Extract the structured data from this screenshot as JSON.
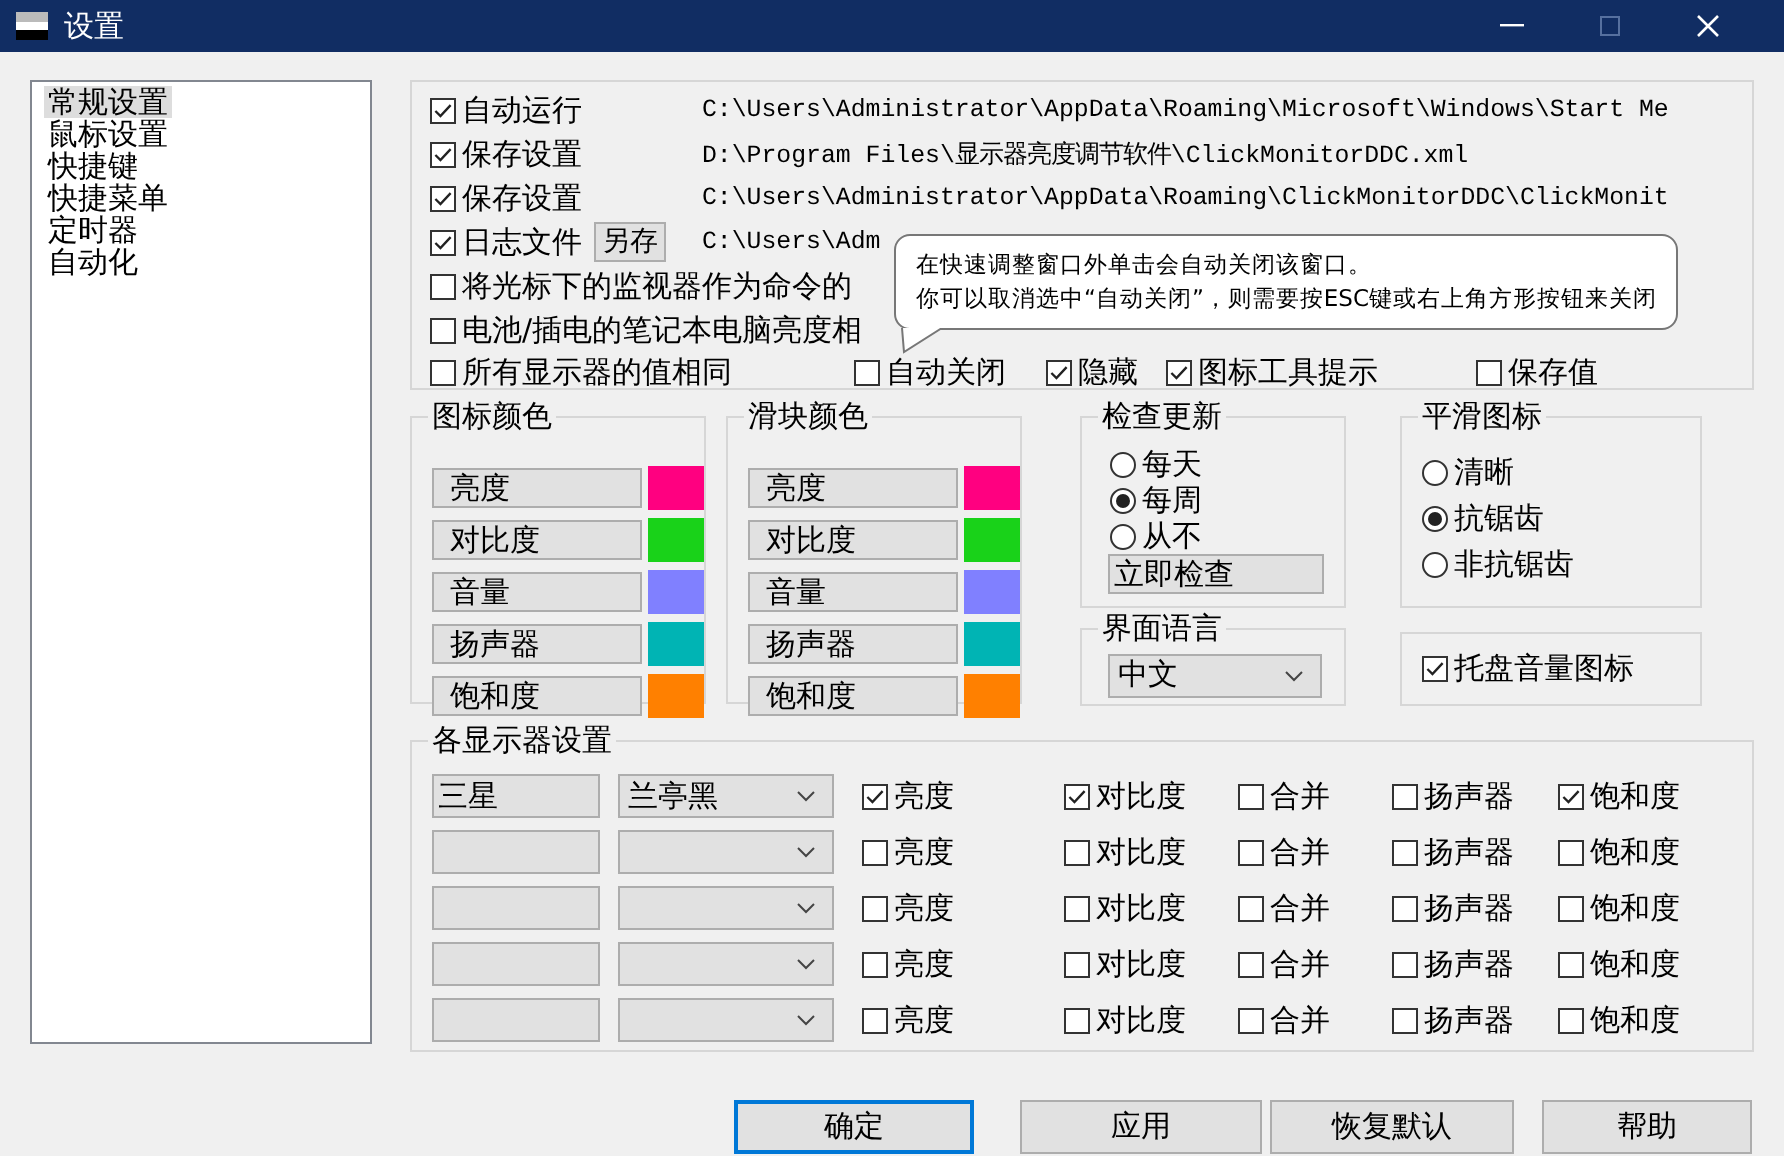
{
  "window": {
    "title": "设置"
  },
  "sidebar": {
    "items": [
      {
        "label": "常规设置",
        "selected": true
      },
      {
        "label": "鼠标设置",
        "selected": false
      },
      {
        "label": "快捷键",
        "selected": false
      },
      {
        "label": "快捷菜单",
        "selected": false
      },
      {
        "label": "定时器",
        "selected": false
      },
      {
        "label": "自动化",
        "selected": false
      }
    ]
  },
  "general": {
    "file_rows": [
      {
        "label": "自动运行",
        "checked": true,
        "path": "C:\\Users\\Administrator\\AppData\\Roaming\\Microsoft\\Windows\\Start Me"
      },
      {
        "label": "保存设置",
        "checked": true,
        "path": "D:\\Program Files\\显示器亮度调节软件\\ClickMonitorDDC.xml"
      },
      {
        "label": "保存设置",
        "checked": true,
        "path": "C:\\Users\\Administrator\\AppData\\Roaming\\ClickMonitorDDC\\ClickMonit"
      },
      {
        "label": "日志文件",
        "checked": true,
        "action": "另存",
        "path": "C:\\Users\\Adm"
      }
    ],
    "toggles": [
      {
        "label": "将光标下的监视器作为命令的",
        "checked": false
      },
      {
        "label": "电池/插电的笔记本电脑亮度相",
        "checked": false
      }
    ],
    "options": [
      {
        "label": "所有显示器的值相同",
        "checked": false
      },
      {
        "label": "自动关闭",
        "checked": false
      },
      {
        "label": "隐藏",
        "checked": true
      },
      {
        "label": "图标工具提示",
        "checked": true
      },
      {
        "label": "保存值",
        "checked": false
      }
    ],
    "tooltip": {
      "lines": [
        "在快速调整窗口外单击会自动关闭该窗口。",
        "你可以取消选中“自动关闭”，则需要按ESC键或右上角方形按钮来关闭"
      ]
    }
  },
  "icon_colors": {
    "title": "图标颜色",
    "items": [
      {
        "label": "亮度",
        "color": "#ff0080"
      },
      {
        "label": "对比度",
        "color": "#19d219"
      },
      {
        "label": "音量",
        "color": "#8080ff"
      },
      {
        "label": "扬声器",
        "color": "#00b4b4"
      },
      {
        "label": "饱和度",
        "color": "#ff8000"
      }
    ]
  },
  "slider_colors": {
    "title": "滑块颜色",
    "items": [
      {
        "label": "亮度",
        "color": "#ff0080"
      },
      {
        "label": "对比度",
        "color": "#19d219"
      },
      {
        "label": "音量",
        "color": "#8080ff"
      },
      {
        "label": "扬声器",
        "color": "#00b4b4"
      },
      {
        "label": "饱和度",
        "color": "#ff8000"
      }
    ]
  },
  "update_check": {
    "title": "检查更新",
    "options": [
      {
        "label": "每天",
        "selected": false
      },
      {
        "label": "每周",
        "selected": true
      },
      {
        "label": "从不",
        "selected": false
      }
    ],
    "button": "立即检查"
  },
  "language": {
    "title": "界面语言",
    "value": "中文"
  },
  "smooth_icons": {
    "title": "平滑图标",
    "options": [
      {
        "label": "清晰",
        "selected": false
      },
      {
        "label": "抗锯齿",
        "selected": true
      },
      {
        "label": "非抗锯齿",
        "selected": false
      }
    ]
  },
  "tray_volume_icon": {
    "label": "托盘音量图标",
    "checked": true
  },
  "monitors": {
    "title": "各显示器设置",
    "rows": [
      {
        "name": "三星",
        "font": "兰亭黑",
        "checks": [
          {
            "label": "亮度",
            "checked": true
          },
          {
            "label": "对比度",
            "checked": true
          },
          {
            "label": "合并",
            "checked": false
          },
          {
            "label": "扬声器",
            "checked": false
          },
          {
            "label": "饱和度",
            "checked": true
          }
        ]
      },
      {
        "checks": [
          {
            "label": "亮度",
            "checked": false
          },
          {
            "label": "对比度",
            "checked": false
          },
          {
            "label": "合并",
            "checked": false
          },
          {
            "label": "扬声器",
            "checked": false
          },
          {
            "label": "饱和度",
            "checked": false
          }
        ]
      },
      {
        "checks": [
          {
            "label": "亮度",
            "checked": false
          },
          {
            "label": "对比度",
            "checked": false
          },
          {
            "label": "合并",
            "checked": false
          },
          {
            "label": "扬声器",
            "checked": false
          },
          {
            "label": "饱和度",
            "checked": false
          }
        ]
      },
      {
        "checks": [
          {
            "label": "亮度",
            "checked": false
          },
          {
            "label": "对比度",
            "checked": false
          },
          {
            "label": "合并",
            "checked": false
          },
          {
            "label": "扬声器",
            "checked": false
          },
          {
            "label": "饱和度",
            "checked": false
          }
        ]
      },
      {
        "checks": [
          {
            "label": "亮度",
            "checked": false
          },
          {
            "label": "对比度",
            "checked": false
          },
          {
            "label": "合并",
            "checked": false
          },
          {
            "label": "扬声器",
            "checked": false
          },
          {
            "label": "饱和度",
            "checked": false
          }
        ]
      }
    ]
  },
  "buttons": [
    {
      "label": "确定",
      "default": true
    },
    {
      "label": "应用",
      "default": false
    },
    {
      "label": "恢复默认",
      "default": false
    },
    {
      "label": "帮助",
      "default": false
    }
  ]
}
